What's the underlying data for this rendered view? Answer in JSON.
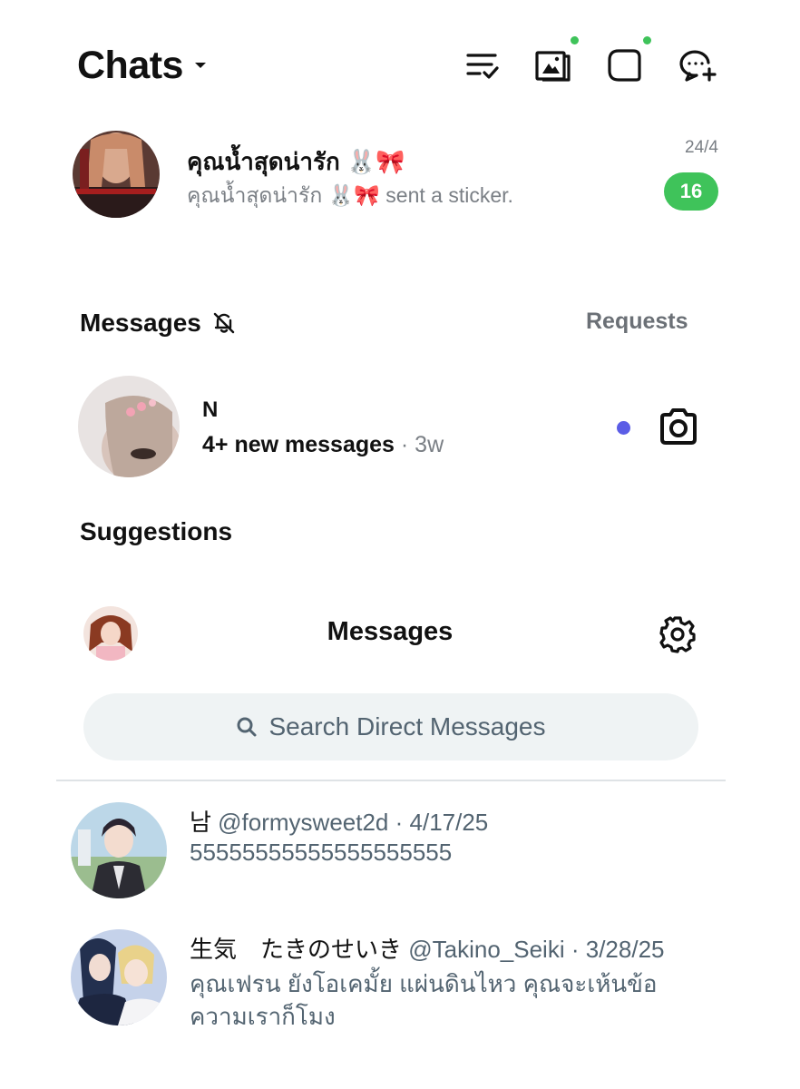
{
  "header": {
    "title": "Chats",
    "icons": [
      "filter-check-icon",
      "photo-folder-icon",
      "speech-square-icon",
      "new-chat-icon"
    ]
  },
  "pinned_chat": {
    "name": "คุณน้ำสุดน่ารัก 🐰🎀",
    "preview": "คุณน้ำสุดน่ารัก 🐰🎀 sent a sticker.",
    "date": "24/4",
    "unread": "16"
  },
  "messages_section": {
    "title": "Messages",
    "requests_label": "Requests",
    "item": {
      "name": "N",
      "preview": "4+ new messages",
      "time": "· 3w"
    }
  },
  "suggestions": {
    "title": "Suggestions"
  },
  "dm_screen": {
    "title": "Messages",
    "search_placeholder": "Search Direct Messages",
    "conversations": [
      {
        "name": "남",
        "handle": "@formysweet2d",
        "date": "· 4/17/25",
        "preview": "55555555555555555555"
      },
      {
        "name": "生気　たきのせいき",
        "handle": "@Takino_Seiki",
        "date": "· 3/28/25",
        "preview_line1": "คุณเฟรน ยังโอเคมั้ย แผ่นดินไหว คุณจะเห้นข้อ",
        "preview_line2": "ความเราก็โมง"
      }
    ]
  },
  "colors": {
    "badge_green": "#3fc35a",
    "unread_dot": "#5b5de6",
    "search_bg": "#eff3f4"
  }
}
